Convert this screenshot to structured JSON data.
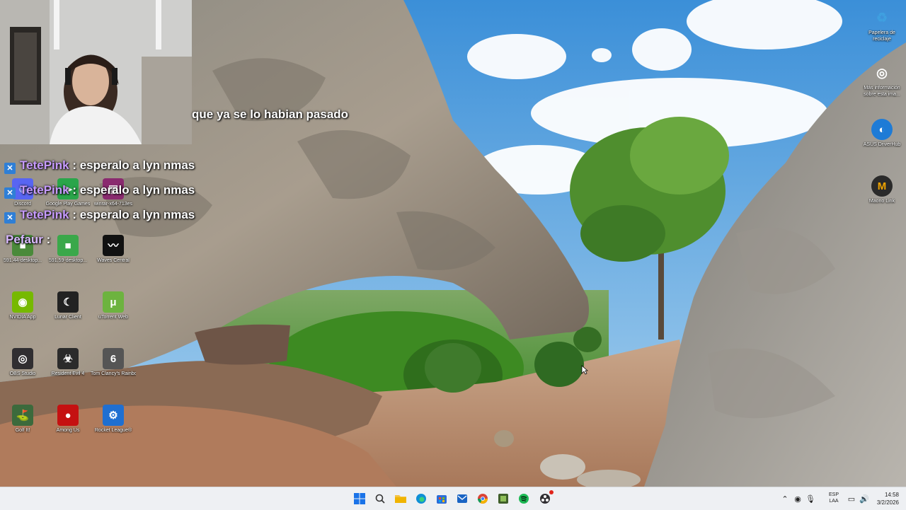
{
  "desktop": {
    "icons_left": [
      {
        "name": "discord-icon",
        "label": "Discord",
        "color": "#5865f2",
        "glyph": "☺"
      },
      {
        "name": "google-play-games-icon",
        "label": "Google Play Games",
        "color": "#2aa54a",
        "glyph": "▶"
      },
      {
        "name": "winrar-icon",
        "label": "winrar-x64-713es",
        "color": "#8a2a6f",
        "glyph": "▤"
      },
      {
        "name": "desktop-file-1-icon",
        "label": "591.44-desktop...",
        "color": "#4a8a3a",
        "glyph": "■"
      },
      {
        "name": "desktop-file-2-icon",
        "label": "591.59-desktop...",
        "color": "#3aa84a",
        "glyph": "■"
      },
      {
        "name": "waves-central-icon",
        "label": "Waves Central",
        "color": "#111111",
        "glyph": "〰"
      },
      {
        "name": "nvidia-app-icon",
        "label": "NVIDIA App",
        "color": "#76b900",
        "glyph": "◉"
      },
      {
        "name": "lunar-client-icon",
        "label": "Lunar Client",
        "color": "#222222",
        "glyph": "☾"
      },
      {
        "name": "utorrent-icon",
        "label": "uTorrent Web",
        "color": "#6db33f",
        "glyph": "μ"
      },
      {
        "name": "obs-studio-icon",
        "label": "OBS Studio",
        "color": "#302e31",
        "glyph": "◎"
      },
      {
        "name": "resident-evil-icon",
        "label": "Resident Evil 4",
        "color": "#2b2b2b",
        "glyph": "☣"
      },
      {
        "name": "rainbow-six-icon",
        "label": "Tom Clancy's Rainbow Six...",
        "color": "#555555",
        "glyph": "6"
      },
      {
        "name": "golf-it-icon",
        "label": "Golf It!",
        "color": "#3c6a3c",
        "glyph": "⛳"
      },
      {
        "name": "among-us-icon",
        "label": "Among Us",
        "color": "#c51111",
        "glyph": "●"
      },
      {
        "name": "rocket-league-icon",
        "label": "Rocket League®",
        "color": "#1f6fd1",
        "glyph": "⚙"
      }
    ],
    "icons_right": [
      {
        "name": "recycle-bin-icon",
        "label": "Papelera de reciclaje",
        "color": "#3fa0e0",
        "glyph": "♻"
      },
      {
        "name": "info-icon",
        "label": "Más información sobre esta ima...",
        "color": "#222222",
        "glyph": "◎"
      },
      {
        "name": "asus-driverhub-icon",
        "label": "ASUS DriverHub",
        "color": "#1e7bd6",
        "glyph": "◐"
      },
      {
        "name": "maono-link-icon",
        "label": "Maono Link",
        "color": "#2a2a2a",
        "glyph": "M"
      }
    ]
  },
  "overlay": {
    "caption": "que ya se lo habian pasado",
    "chat": [
      {
        "user": "TetePink",
        "sep": " : ",
        "message": "esperalo a lyn nmas"
      },
      {
        "user": "TetePink",
        "sep": " : ",
        "message": "esperalo a lyn nmas"
      },
      {
        "user": "TetePink",
        "sep": " : ",
        "message": "esperalo a lyn nmas"
      },
      {
        "user": "Pefaur",
        "sep": " :",
        "message": ""
      }
    ]
  },
  "taskbar": {
    "apps": [
      {
        "name": "start-button",
        "glyph": "⊞",
        "color": "#1a73e8"
      },
      {
        "name": "search-icon",
        "glyph": "⌕",
        "color": "#333333"
      },
      {
        "name": "file-explorer-icon",
        "glyph": "▰",
        "color": "#f0b400"
      },
      {
        "name": "edge-icon",
        "glyph": "◐",
        "color": "#0f8fd6"
      },
      {
        "name": "store-icon",
        "glyph": "▣",
        "color": "#2b6cd8"
      },
      {
        "name": "outlook-icon",
        "glyph": "✉",
        "color": "#1a64c4"
      },
      {
        "name": "chrome-icon",
        "glyph": "◉",
        "color": "#db4437"
      },
      {
        "name": "app-green-icon",
        "glyph": "▦",
        "color": "#3f5f2a"
      },
      {
        "name": "spotify-icon",
        "glyph": "◉",
        "color": "#1db954"
      },
      {
        "name": "obs-taskbar-icon",
        "glyph": "◎",
        "color": "#302e31"
      }
    ],
    "tray": {
      "lang_top": "ESP",
      "lang_bottom": "LAA",
      "time": "14:58",
      "date": "3/2/2026"
    }
  }
}
